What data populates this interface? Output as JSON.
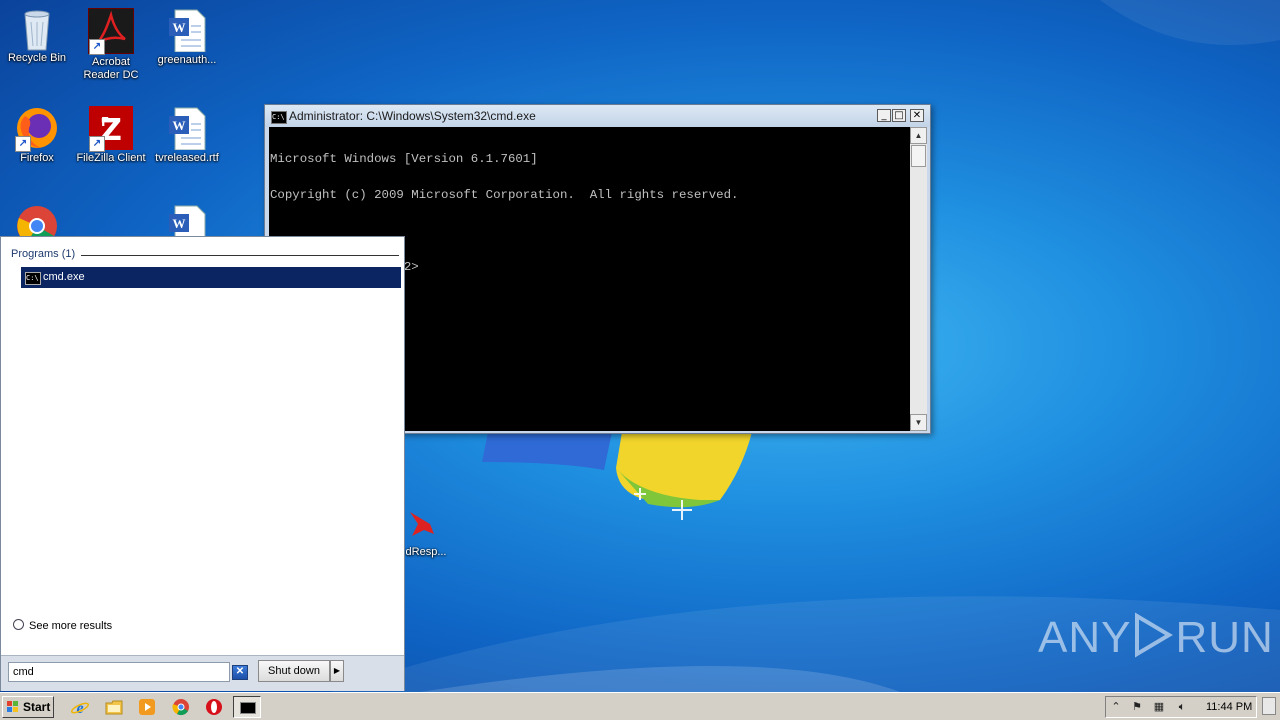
{
  "desktop": {
    "icons": [
      {
        "label": "Recycle Bin",
        "icon": "recycle-bin-icon"
      },
      {
        "label": "Acrobat Reader DC",
        "icon": "acrobat-icon"
      },
      {
        "label": "greenauth...",
        "icon": "word-document-icon"
      },
      {
        "label": "Firefox",
        "icon": "firefox-icon"
      },
      {
        "label": "FileZilla Client",
        "icon": "filezilla-icon"
      },
      {
        "label": "tvreleased.rtf",
        "icon": "word-document-icon"
      },
      {
        "label": "dResp...",
        "icon": "cardinal-app-icon"
      }
    ],
    "icon_labels": {
      "recycle_bin": "Recycle Bin",
      "acrobat_line1": "Acrobat",
      "acrobat_line2": "Reader DC",
      "greenauth": "greenauth...",
      "firefox": "Firefox",
      "filezilla": "FileZilla Client",
      "tvreleased": "tvreleased.rtf",
      "partial": "dResp..."
    }
  },
  "cmd_window": {
    "title": "Administrator: C:\\Windows\\System32\\cmd.exe",
    "icon_text": "C:\\",
    "lines": [
      "Microsoft Windows [Version 6.1.7601]",
      "Copyright (c) 2009 Microsoft Corporation.  All rights reserved.",
      "",
      "C:\\Windows\\system32>"
    ],
    "controls": {
      "minimize": "_",
      "maximize": "□",
      "close": "✕"
    }
  },
  "start_menu": {
    "programs_header": "Programs (1)",
    "results": [
      {
        "label": "cmd.exe",
        "icon": "cmd-icon"
      }
    ],
    "see_more": "See more results",
    "search_value": "cmd",
    "shutdown_label": "Shut down",
    "shutdown_arrow": "▶"
  },
  "taskbar": {
    "start_label": "Start",
    "pinned": [
      "internet-explorer-icon",
      "windows-explorer-icon",
      "media-player-icon",
      "chrome-icon",
      "opera-icon",
      "cmd-icon"
    ],
    "clock": "11:44 PM",
    "tray_icons": [
      "show-hidden-icons-icon",
      "action-center-flag-icon",
      "network-icon",
      "volume-icon"
    ]
  },
  "watermark": {
    "left": "ANY",
    "right": "RUN"
  },
  "colors": {
    "selection": "#0b2563",
    "console_bg": "#000000",
    "console_fg": "#c0c0c0",
    "taskbar": "#d4d0c8"
  }
}
